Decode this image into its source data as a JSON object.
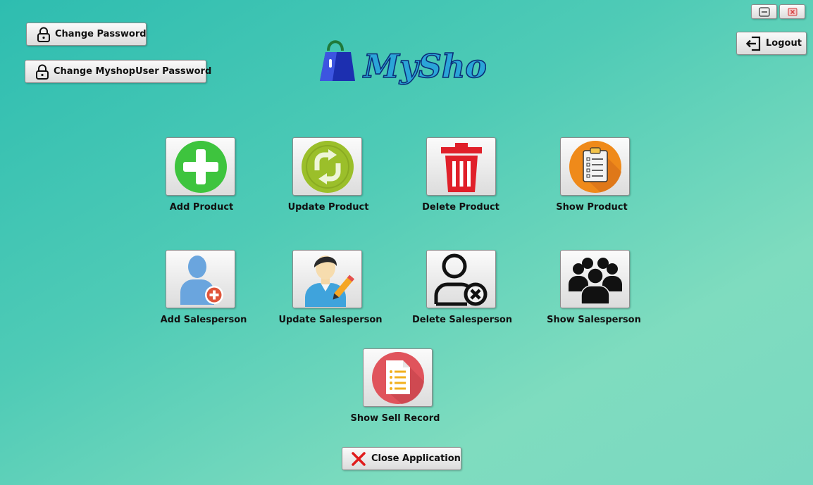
{
  "logo": {
    "text": "MyShop"
  },
  "top_buttons": {
    "change_password": "Change Password",
    "change_myshopuser_password": "Change MyshopUser Password",
    "logout": "Logout"
  },
  "tiles": {
    "add_product": "Add Product",
    "update_product": "Update Product",
    "delete_product": "Delete Product",
    "show_product": "Show Product",
    "add_salesperson": "Add Salesperson",
    "update_salesperson": "Update Salesperson",
    "delete_salesperson": "Delete Salesperson",
    "show_salesperson": "Show Salesperson",
    "show_sell_record": "Show Sell Record"
  },
  "close_button": "Close Application",
  "colors": {
    "add": "#3ec43e",
    "update": "#9bbf2a",
    "delete": "#e0202a",
    "show": "#ef8a1a",
    "sell": "#e0545c"
  }
}
